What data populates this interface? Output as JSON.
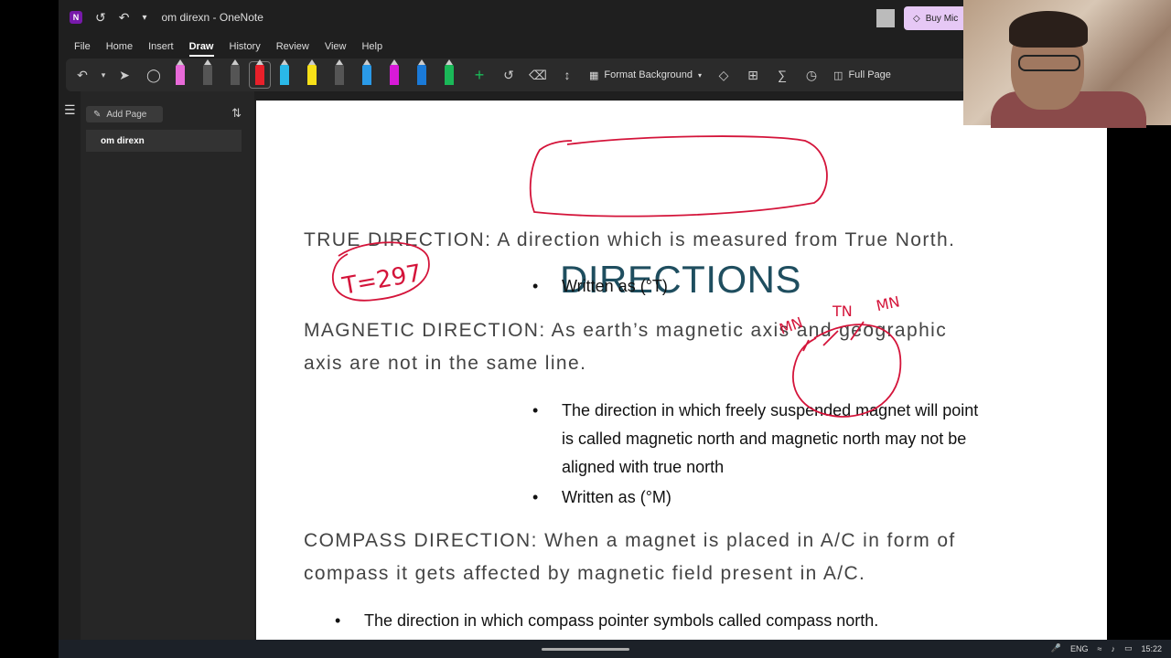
{
  "window": {
    "title": "om direxn",
    "app": "OneNote",
    "separator": " - "
  },
  "buy_button": {
    "label": "Buy Mic"
  },
  "menu": [
    "File",
    "Home",
    "Insert",
    "Draw",
    "History",
    "Review",
    "View",
    "Help"
  ],
  "toolbar": {
    "format_background": "Format Background",
    "full_page": "Full Page"
  },
  "pen_colors": [
    "#e86ad8",
    "#222222",
    "#222222",
    "#e8202a",
    "#2ab8e8",
    "#f7e018",
    "#222222",
    "#2a9ae8",
    "#d81ad8",
    "#1a7ad8",
    "#1ab858"
  ],
  "sidebar": {
    "add_page": "Add Page",
    "pages": [
      "om direxn"
    ]
  },
  "note": {
    "heading": "DIRECTIONS",
    "true_dir": "TRUE DIRECTION: A direction which is measured from True North.",
    "true_b1": "Written as (°T)",
    "mag_l1": "MAGNETIC DIRECTION: As earth’s magnetic axis and geographic",
    "mag_l2": "axis are not in the same line.",
    "mag_b1a": "The direction in which freely suspended magnet will point",
    "mag_b1b": "is called magnetic north and magnetic north may not be",
    "mag_b1c": "aligned with true north",
    "mag_b2": "Written as (°M)",
    "comp_l1": "COMPASS DIRECTION: When a magnet is placed in A/C in form of",
    "comp_l2": "compass it gets affected by magnetic field present in A/C.",
    "comp_b1": "The direction in which compass pointer symbols called compass north."
  },
  "ink": {
    "t_annotation": "T=297",
    "mn_left": "MN",
    "tn": "TN",
    "mn_right": "MN",
    "color": "#d4143a"
  },
  "taskbar": {
    "lang": "ENG",
    "time": "15:22"
  }
}
